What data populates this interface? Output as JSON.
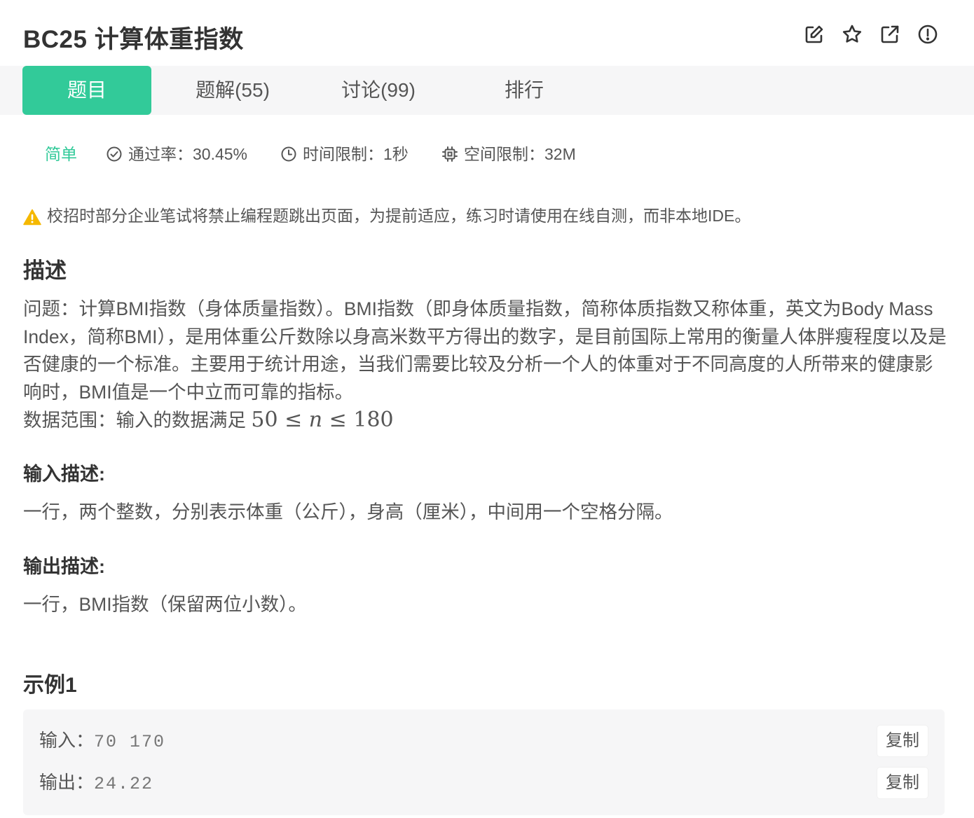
{
  "header": {
    "title": "BC25  计算体重指数",
    "icons": [
      "edit-icon",
      "star-icon",
      "share-icon",
      "report-icon"
    ]
  },
  "tabs": [
    {
      "label": "题目",
      "active": true
    },
    {
      "label": "题解(55)",
      "active": false
    },
    {
      "label": "讨论(99)",
      "active": false
    },
    {
      "label": "排行",
      "active": false
    }
  ],
  "meta": {
    "level": "简单",
    "pass_rate": "通过率：30.45%",
    "time_limit": "时间限制：1秒",
    "space_limit": "空间限制：32M"
  },
  "notice": "校招时部分企业笔试将禁止编程题跳出页面，为提前适应，练习时请使用在线自测，而非本地IDE。",
  "description": {
    "heading": "描述",
    "text": "问题：计算BMI指数（身体质量指数）。BMI指数（即身体质量指数，简称体质指数又称体重，英文为Body Mass Index，简称BMI），是用体重公斤数除以身高米数平方得出的数字，是目前国际上常用的衡量人体胖瘦程度以及是否健康的一个标准。主要用于统计用途，当我们需要比较及分析一个人的体重对于不同高度的人所带来的健康影响时，BMI值是一个中立而可靠的指标。",
    "range_label": "数据范围：输入的数据满足 ",
    "range_math": {
      "low": "50",
      "var": "n",
      "high": "180",
      "op": "≤"
    }
  },
  "input_desc": {
    "heading": "输入描述:",
    "text": "一行，两个整数，分别表示体重（公斤），身高（厘米），中间用一个空格分隔。"
  },
  "output_desc": {
    "heading": "输出描述:",
    "text": "一行，BMI指数（保留两位小数）。"
  },
  "example": {
    "heading": "示例1",
    "input_label": "输入：",
    "input_value": "70 170",
    "output_label": "输出：",
    "output_value": "24.22",
    "copy_label": "复制"
  }
}
